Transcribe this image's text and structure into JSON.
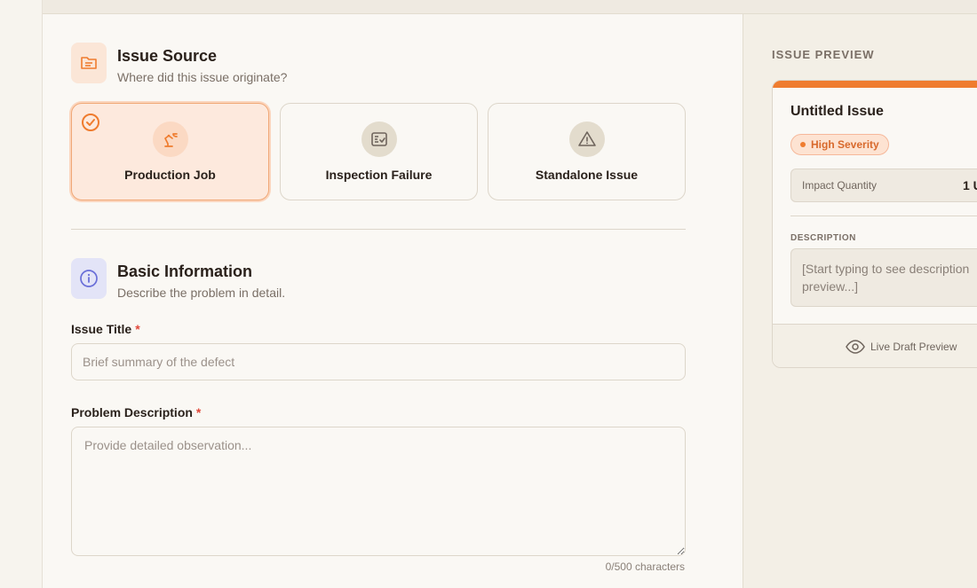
{
  "issue_source": {
    "title": "Issue Source",
    "subtitle": "Where did this issue originate?",
    "cards": [
      {
        "label": "Production Job",
        "icon": "robot-arm-icon",
        "selected": true
      },
      {
        "label": "Inspection Failure",
        "icon": "checklist-icon",
        "selected": false
      },
      {
        "label": "Standalone Issue",
        "icon": "warning-icon",
        "selected": false
      }
    ]
  },
  "basic_info": {
    "title": "Basic Information",
    "subtitle": "Describe the problem in detail.",
    "issue_title_label": "Issue Title",
    "required_mark": "*",
    "issue_title_placeholder": "Brief summary of the defect",
    "description_label": "Problem Description",
    "description_placeholder": "Provide detailed observation...",
    "char_count": "0/500 characters"
  },
  "preview": {
    "section_label": "ISSUE PREVIEW",
    "title": "Untitled Issue",
    "severity": "High Severity",
    "impact_label": "Impact Quantity",
    "impact_value": "1 U",
    "description_label": "DESCRIPTION",
    "description_placeholder": "[Start typing to see description preview...]",
    "footer": "Live Draft Preview"
  },
  "colors": {
    "accent": "#ef7c2f",
    "required": "#e0483a",
    "info_blue": "#6a6fd8"
  }
}
